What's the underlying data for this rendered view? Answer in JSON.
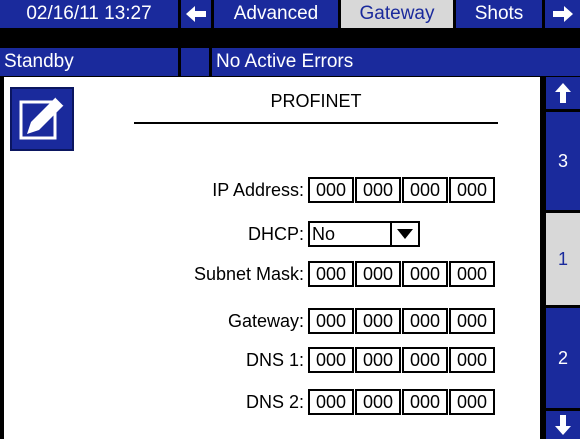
{
  "header": {
    "datetime": "02/16/11 13:27",
    "tabs": [
      {
        "label": "Advanced",
        "active": false
      },
      {
        "label": "Gateway",
        "active": true
      },
      {
        "label": "Shots",
        "active": false
      }
    ]
  },
  "status": {
    "state": "Standby",
    "errors": "No Active Errors"
  },
  "panel": {
    "title": "PROFINET",
    "fields": {
      "ip_address": {
        "label": "IP Address:",
        "octets": [
          "000",
          "000",
          "000",
          "000"
        ]
      },
      "dhcp": {
        "label": "DHCP:",
        "value": "No"
      },
      "subnet_mask": {
        "label": "Subnet Mask:",
        "octets": [
          "000",
          "000",
          "000",
          "000"
        ]
      },
      "gateway": {
        "label": "Gateway:",
        "octets": [
          "000",
          "000",
          "000",
          "000"
        ]
      },
      "dns1": {
        "label": "DNS 1:",
        "octets": [
          "000",
          "000",
          "000",
          "000"
        ]
      },
      "dns2": {
        "label": "DNS 2:",
        "octets": [
          "000",
          "000",
          "000",
          "000"
        ]
      }
    }
  },
  "side_nav": {
    "pages": [
      {
        "label": "3",
        "active": false
      },
      {
        "label": "1",
        "active": true
      },
      {
        "label": "2",
        "active": false
      }
    ]
  },
  "colors": {
    "bar_blue": "#1a2a9c",
    "active_tab": "#d8d8d8"
  },
  "icons": [
    "arrow-left-icon",
    "arrow-right-icon",
    "edit-icon",
    "arrow-up-icon",
    "arrow-down-icon",
    "dropdown-arrow-icon"
  ]
}
